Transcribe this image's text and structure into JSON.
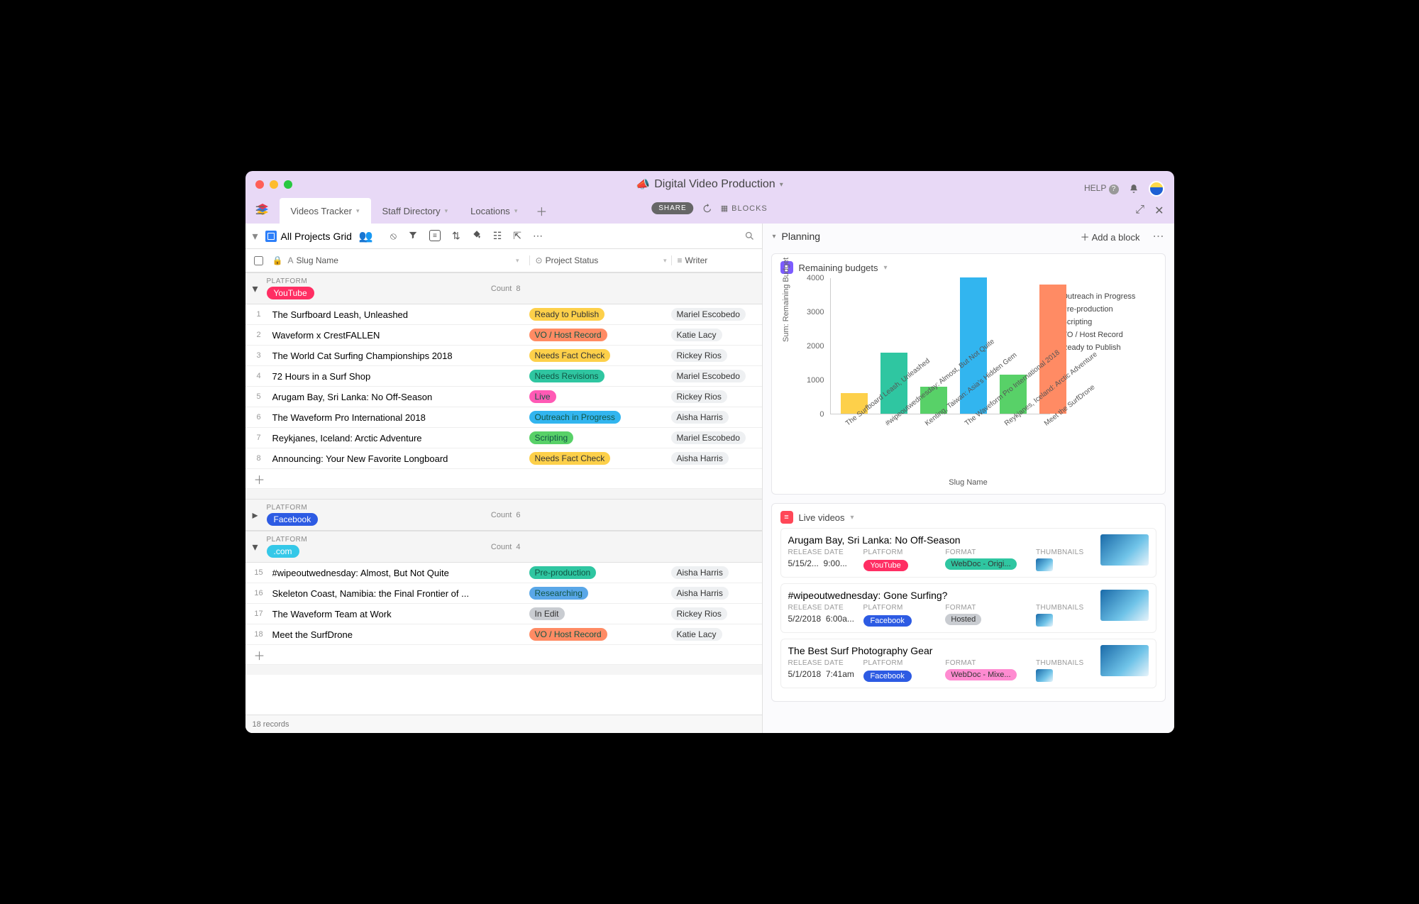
{
  "base": {
    "title": "Digital Video Production"
  },
  "topbar": {
    "help": "HELP",
    "share": "SHARE",
    "blocks": "BLOCKS"
  },
  "tabs": [
    {
      "label": "Videos Tracker",
      "active": true
    },
    {
      "label": "Staff Directory",
      "active": false
    },
    {
      "label": "Locations",
      "active": false
    }
  ],
  "view": {
    "name": "All Projects Grid"
  },
  "columns": {
    "slug": "Slug Name",
    "status": "Project Status",
    "writer": "Writer"
  },
  "status_colors": {
    "Ready to Publish": "#fdd04a",
    "VO / Host Record": "#ff8b64",
    "Needs Fact Check": "#fdd04a",
    "Needs Revisions": "#2fc6a1",
    "Live": "#ff5ab5",
    "Outreach in Progress": "#32b5ef",
    "Scripting": "#58d168",
    "Pre-production": "#2fc6a1",
    "Researching": "#59a7e8",
    "In Edit": "#c9ccd1"
  },
  "platform_colors": {
    "YouTube": "#ff2e63",
    "Facebook": "#2d5be3",
    ".com": "#35c8e8"
  },
  "groups": [
    {
      "platform_label": "PLATFORM",
      "platform": "YouTube",
      "count_label": "Count",
      "count": 8,
      "expanded": true,
      "rows": [
        {
          "n": 1,
          "name": "The Surfboard Leash, Unleashed",
          "status": "Ready to Publish",
          "writer": "Mariel Escobedo"
        },
        {
          "n": 2,
          "name": "Waveform x CrestFALLEN",
          "status": "VO / Host Record",
          "writer": "Katie Lacy"
        },
        {
          "n": 3,
          "name": "The World Cat Surfing Championships 2018",
          "status": "Needs Fact Check",
          "writer": "Rickey Rios"
        },
        {
          "n": 4,
          "name": "72 Hours in a Surf Shop",
          "status": "Needs Revisions",
          "writer": "Mariel Escobedo"
        },
        {
          "n": 5,
          "name": "Arugam Bay, Sri Lanka: No Off-Season",
          "status": "Live",
          "writer": "Rickey Rios"
        },
        {
          "n": 6,
          "name": "The Waveform Pro International 2018",
          "status": "Outreach in Progress",
          "writer": "Aisha Harris"
        },
        {
          "n": 7,
          "name": "Reykjanes, Iceland: Arctic Adventure",
          "status": "Scripting",
          "writer": "Mariel Escobedo"
        },
        {
          "n": 8,
          "name": "Announcing: Your New Favorite Longboard",
          "status": "Needs Fact Check",
          "writer": "Aisha Harris"
        }
      ]
    },
    {
      "platform_label": "PLATFORM",
      "platform": "Facebook",
      "count_label": "Count",
      "count": 6,
      "expanded": false,
      "rows": []
    },
    {
      "platform_label": "PLATFORM",
      "platform": ".com",
      "count_label": "Count",
      "count": 4,
      "expanded": true,
      "rows": [
        {
          "n": 15,
          "name": "#wipeoutwednesday: Almost, But Not Quite",
          "status": "Pre-production",
          "writer": "Aisha Harris"
        },
        {
          "n": 16,
          "name": "Skeleton Coast, Namibia: the Final Frontier of ...",
          "status": "Researching",
          "writer": "Aisha Harris"
        },
        {
          "n": 17,
          "name": "The Waveform Team at Work",
          "status": "In Edit",
          "writer": "Rickey Rios"
        },
        {
          "n": 18,
          "name": "Meet the SurfDrone",
          "status": "VO / Host Record",
          "writer": "Katie Lacy"
        }
      ]
    }
  ],
  "footer": {
    "records": "18 records"
  },
  "planning": {
    "title": "Planning",
    "add": "Add a block",
    "blocks": {
      "chart": {
        "title": "Remaining budgets"
      },
      "live": {
        "title": "Live videos",
        "col_labels": {
          "release": "RELEASE DATE",
          "platform": "PLATFORM",
          "format": "FORMAT",
          "thumb": "THUMBNAILS"
        },
        "cards": [
          {
            "title": "Arugam Bay, Sri Lanka: No Off-Season",
            "date": "5/15/2...",
            "time": "9:00...",
            "platform": "YouTube",
            "format": "WebDoc - Origi...",
            "format_color": "#2fc6a1"
          },
          {
            "title": "#wipeoutwednesday: Gone Surfing?",
            "date": "5/2/2018",
            "time": "6:00a...",
            "platform": "Facebook",
            "format": "Hosted",
            "format_color": "#c9ccd1"
          },
          {
            "title": "The Best Surf Photography Gear",
            "date": "5/1/2018",
            "time": "7:41am",
            "platform": "Facebook",
            "format": "WebDoc - Mixe...",
            "format_color": "#ff8bd1"
          }
        ]
      }
    }
  },
  "chart_data": {
    "type": "bar",
    "title": "Remaining budgets",
    "xlabel": "Slug Name",
    "ylabel": "Sum: Remaining Budget",
    "ylim": [
      0,
      4000
    ],
    "yticks": [
      0,
      1000,
      2000,
      3000,
      4000
    ],
    "categories": [
      "The Surfboard Leash, Unleashed",
      "#wipeoutwednesday: Almost, But Not Quite",
      "Kenting, Taiwan: Asia's Hidden Gem",
      "The Waveform Pro International 2018",
      "Reykjanes, Iceland: Arctic Adventure",
      "Meet the SurfDrone"
    ],
    "values": [
      600,
      1800,
      800,
      4000,
      1150,
      3800
    ],
    "series_status": [
      "Ready to Publish",
      "Pre-production",
      "Scripting",
      "Outreach in Progress",
      "Scripting",
      "VO / Host Record"
    ],
    "legend": [
      "Outreach in Progress",
      "Pre-production",
      "Scripting",
      "VO / Host Record",
      "Ready to Publish"
    ],
    "legend_colors": {
      "Outreach in Progress": "#32b5ef",
      "Pre-production": "#2fc6a1",
      "Scripting": "#58d168",
      "VO / Host Record": "#ff8b64",
      "Ready to Publish": "#fdd04a"
    }
  }
}
